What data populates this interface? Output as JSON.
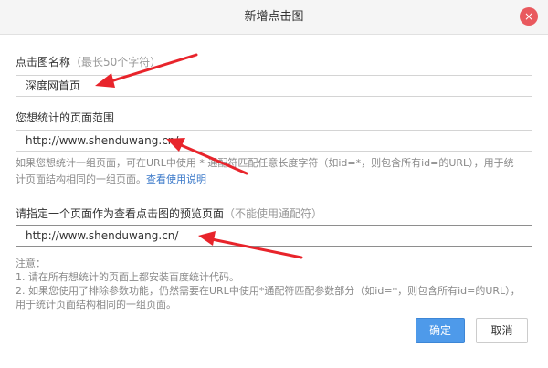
{
  "dialog": {
    "title": "新增点击图",
    "close_glyph": "×"
  },
  "name_field": {
    "label": "点击图名称",
    "hint": "（最长50个字符）",
    "value": "深度网首页"
  },
  "scope_field": {
    "label": "您想统计的页面范围",
    "value": "http://www.shenduwang.cn/",
    "help_line1": "如果您想统计一组页面，可在URL中使用 * 通配符匹配任意长度字符（如id=*，则包含所有id=的URL），用于统",
    "help_line2_prefix": "计页面结构相同的一组页面。",
    "help_link": "查看使用说明"
  },
  "preview_field": {
    "label": "请指定一个页面作为查看点击图的预览页面",
    "hint": "（不能使用通配符）",
    "value": "http://www.shenduwang.cn/"
  },
  "notes": {
    "heading": "注意：",
    "line1": "1. 请在所有想统计的页面上都安装百度统计代码。",
    "line2": "2. 如果您使用了排除参数功能，仍然需要在URL中使用*通配符匹配参数部分（如id=*，则包含所有id=的URL），",
    "line3": "用于统计页面结构相同的一组页面。"
  },
  "buttons": {
    "ok": "确定",
    "cancel": "取消"
  },
  "colors": {
    "primary": "#4e9aea",
    "close": "#e9595e",
    "link": "#3b79c9",
    "annotation_arrow": "#e8242b"
  }
}
